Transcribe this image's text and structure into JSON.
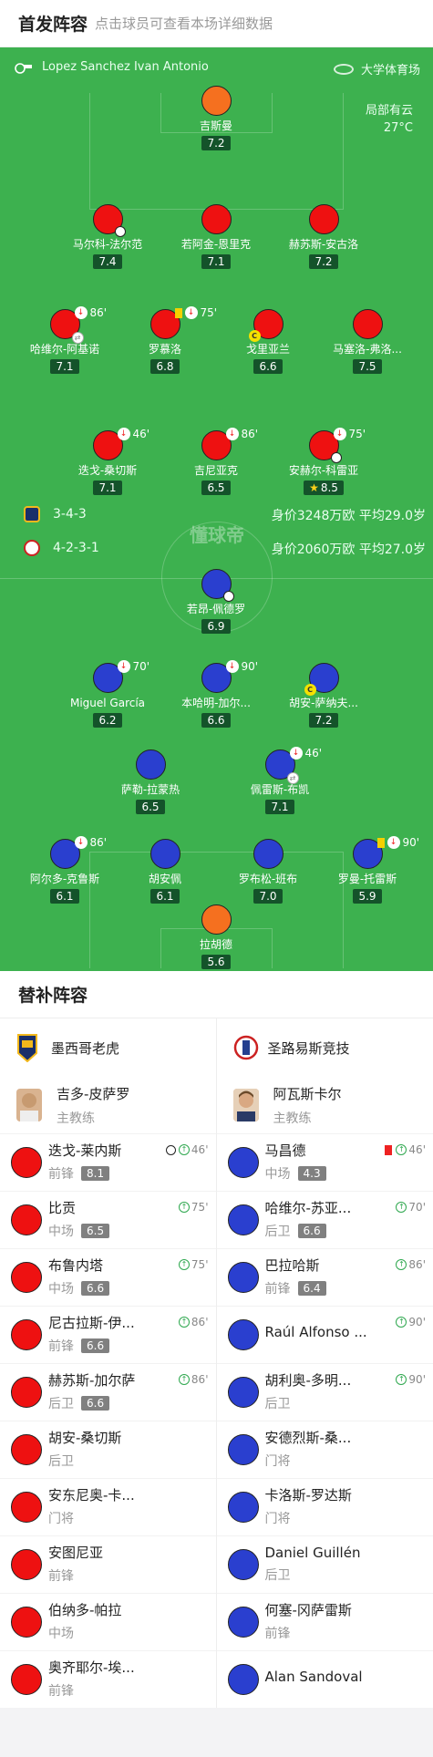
{
  "header": {
    "title": "首发阵容",
    "subtitle": "点击球员可查看本场详细数据"
  },
  "match_info": {
    "referee": "Lopez Sanchez Ivan Antonio",
    "venue": "大学体育场",
    "weather": "局部有云",
    "temperature": "27°C"
  },
  "watermark": "懂球帝",
  "home_summary": {
    "formation": "3-4-3",
    "value": "身价3248万欧 平均29.0岁"
  },
  "away_summary": {
    "formation": "4-2-3-1",
    "value": "身价2060万欧 平均27.0岁"
  },
  "home_players": [
    {
      "name": "吉斯曼",
      "rating": "7.2",
      "color": "orange"
    },
    {
      "name": "马尔科-法尔范",
      "rating": "7.4",
      "goal": true
    },
    {
      "name": "若阿金-恩里克",
      "rating": "7.1"
    },
    {
      "name": "赫苏斯-安古洛",
      "rating": "7.2"
    },
    {
      "name": "哈维尔-阿基诺",
      "rating": "7.1",
      "sub_min": "86'",
      "swap": true
    },
    {
      "name": "罗慕洛",
      "rating": "6.8",
      "sub_min": "75'",
      "yellow": true
    },
    {
      "name": "戈里亚兰",
      "rating": "6.6",
      "captain": true
    },
    {
      "name": "马塞洛-弗洛...",
      "rating": "7.5"
    },
    {
      "name": "迭戈-桑切斯",
      "rating": "7.1",
      "sub_min": "46'"
    },
    {
      "name": "吉尼亚克",
      "rating": "6.5",
      "sub_min": "86'"
    },
    {
      "name": "安赫尔-科雷亚",
      "rating": "8.5",
      "sub_min": "75'",
      "goal": true,
      "star": true
    }
  ],
  "away_players": [
    {
      "name": "若昂-佩德罗",
      "rating": "6.9",
      "goal": true
    },
    {
      "name": "Miguel García",
      "rating": "6.2",
      "sub_min": "70'"
    },
    {
      "name": "本哈明-加尔...",
      "rating": "6.6",
      "sub_min": "90'"
    },
    {
      "name": "胡安-萨纳夫...",
      "rating": "7.2",
      "captain": true
    },
    {
      "name": "萨勒-拉蒙热",
      "rating": "6.5"
    },
    {
      "name": "佩雷斯-布凯",
      "rating": "7.1",
      "sub_min": "46'",
      "swap": true
    },
    {
      "name": "阿尔多-克鲁斯",
      "rating": "6.1",
      "sub_min": "86'"
    },
    {
      "name": "胡安佩",
      "rating": "6.1"
    },
    {
      "name": "罗布松-班布",
      "rating": "7.0"
    },
    {
      "name": "罗曼-托雷斯",
      "rating": "5.9",
      "sub_min": "90'",
      "yellow": true
    },
    {
      "name": "拉胡德",
      "rating": "5.6",
      "color": "orange"
    }
  ],
  "subs": {
    "title": "替补阵容",
    "home": {
      "team": "墨西哥老虎",
      "coach": {
        "name": "吉多-皮萨罗",
        "role": "主教练"
      },
      "players": [
        {
          "name": "迭戈-莱内斯",
          "pos": "前锋",
          "rating": "8.1",
          "min": "46'",
          "goal": true
        },
        {
          "name": "比贡",
          "pos": "中场",
          "rating": "6.5",
          "min": "75'"
        },
        {
          "name": "布鲁内塔",
          "pos": "中场",
          "rating": "6.6",
          "min": "75'"
        },
        {
          "name": "尼古拉斯-伊...",
          "pos": "前锋",
          "rating": "6.6",
          "min": "86'"
        },
        {
          "name": "赫苏斯-加尔萨",
          "pos": "后卫",
          "rating": "6.6",
          "min": "86'"
        },
        {
          "name": "胡安-桑切斯",
          "pos": "后卫"
        },
        {
          "name": "安东尼奥-卡...",
          "pos": "门将"
        },
        {
          "name": "安图尼亚",
          "pos": "前锋"
        },
        {
          "name": "伯纳多-帕拉",
          "pos": "中场"
        },
        {
          "name": "奥齐耶尔-埃...",
          "pos": "前锋"
        }
      ]
    },
    "away": {
      "team": "圣路易斯竞技",
      "coach": {
        "name": "阿瓦斯卡尔",
        "role": "主教练"
      },
      "players": [
        {
          "name": "马昌德",
          "pos": "中场",
          "rating": "4.3",
          "min": "46'",
          "red": true
        },
        {
          "name": "哈维尔-苏亚...",
          "pos": "后卫",
          "rating": "6.6",
          "min": "70'"
        },
        {
          "name": "巴拉哈斯",
          "pos": "前锋",
          "rating": "6.4",
          "min": "86'"
        },
        {
          "name": "Raúl Alfonso ...",
          "pos": "",
          "min": "90'"
        },
        {
          "name": "胡利奥-多明...",
          "pos": "后卫",
          "min": "90'"
        },
        {
          "name": "安德烈斯-桑...",
          "pos": "门将"
        },
        {
          "name": "卡洛斯-罗达斯",
          "pos": "门将"
        },
        {
          "name": "Daniel Guillén",
          "pos": "后卫"
        },
        {
          "name": "何塞-冈萨雷斯",
          "pos": "前锋"
        },
        {
          "name": "Alan Sandoval",
          "pos": ""
        }
      ]
    }
  }
}
